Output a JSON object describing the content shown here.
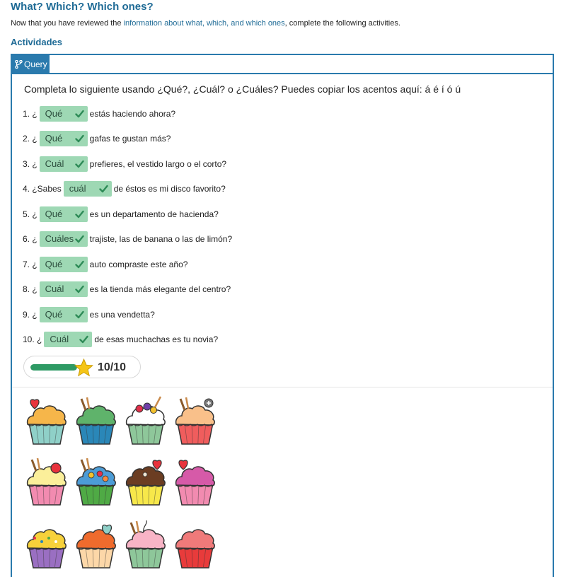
{
  "page": {
    "title": "What? Which? Which ones?",
    "intro_before": "Now that you have reviewed the ",
    "intro_link": "information about what, which, and which ones",
    "intro_after": ", complete the following activities.",
    "section_title": "Actividades"
  },
  "activity": {
    "tab_label": "Query",
    "tab_icon": "branch-icon",
    "instructions": "Completa lo siguiente usando ¿Qué?, ¿Cuál? o ¿Cuáles? Puedes copiar los acentos aquí: á é í ó ú",
    "questions": [
      {
        "prefix": "1. ¿",
        "answer": "Qué",
        "suffix": "estás haciendo ahora?"
      },
      {
        "prefix": "2.  ¿",
        "answer": "Qué",
        "suffix": "gafas te gustan más?"
      },
      {
        "prefix": "3. ¿",
        "answer": "Cuál",
        "suffix": "prefieres, el vestido largo o el corto?"
      },
      {
        "prefix": "4. ¿Sabes",
        "answer": "cuál",
        "suffix": "de éstos es mi disco favorito?"
      },
      {
        "prefix": "5. ¿",
        "answer": "Qué",
        "suffix": "es un departamento de hacienda?"
      },
      {
        "prefix": "6. ¿",
        "answer": "Cuáles",
        "suffix": "trajiste, las de banana o las de limón?"
      },
      {
        "prefix": "7. ¿",
        "answer": "Qué",
        "suffix": "auto compraste este año?"
      },
      {
        "prefix": "8. ¿",
        "answer": "Cuál",
        "suffix": "es la tienda más elegante del centro?"
      },
      {
        "prefix": "9. ¿",
        "answer": "Qué",
        "suffix": "es una vendetta?"
      },
      {
        "prefix": "10. ¿",
        "answer": "Cuál",
        "suffix": "de esas muchachas es tu novia?"
      }
    ],
    "score": {
      "correct": 10,
      "total": 10,
      "label": "10/10",
      "progress": 1.0
    },
    "colors": {
      "accent": "#2a7aad",
      "chip": "#9ed8b4",
      "check": "#2e8b57",
      "progress": "#2e9a64",
      "star": "#f5c518"
    }
  },
  "cupcakes": [
    {
      "topper": "heart",
      "frosting": "#f6b64a",
      "wrapper": "#8fd0c8"
    },
    {
      "topper": "sticks",
      "frosting": "#5fb36b",
      "wrapper": "#2a87b8"
    },
    {
      "topper": "fruits",
      "frosting": "#ffffff",
      "wrapper": "#8ec79a"
    },
    {
      "topper": "sticks-plus",
      "frosting": "#f9c08a",
      "wrapper": "#f05d5d"
    },
    {
      "topper": "sticks-cherry",
      "frosting": "#fbef9a",
      "wrapper": "#f28bb0"
    },
    {
      "topper": "sticks-candy",
      "frosting": "#4c9cd6",
      "wrapper": "#4faa45"
    },
    {
      "topper": "heart-chocolate",
      "frosting": "#6b3d22",
      "wrapper": "#f7e84a"
    },
    {
      "topper": "heart",
      "frosting": "#d65aa8",
      "wrapper": "#f28bb0"
    },
    {
      "topper": "sprinkles",
      "frosting": "#f7d13a",
      "wrapper": "#9a6fc2"
    },
    {
      "topper": "none",
      "frosting": "#ef6b2d",
      "wrapper": "#fcd7a8"
    },
    {
      "topper": "sticks-swirl",
      "frosting": "#f8b4c6",
      "wrapper": "#8ec79a"
    },
    {
      "topper": "none",
      "frosting": "#f07a7a",
      "wrapper": "#e83b3b"
    }
  ]
}
